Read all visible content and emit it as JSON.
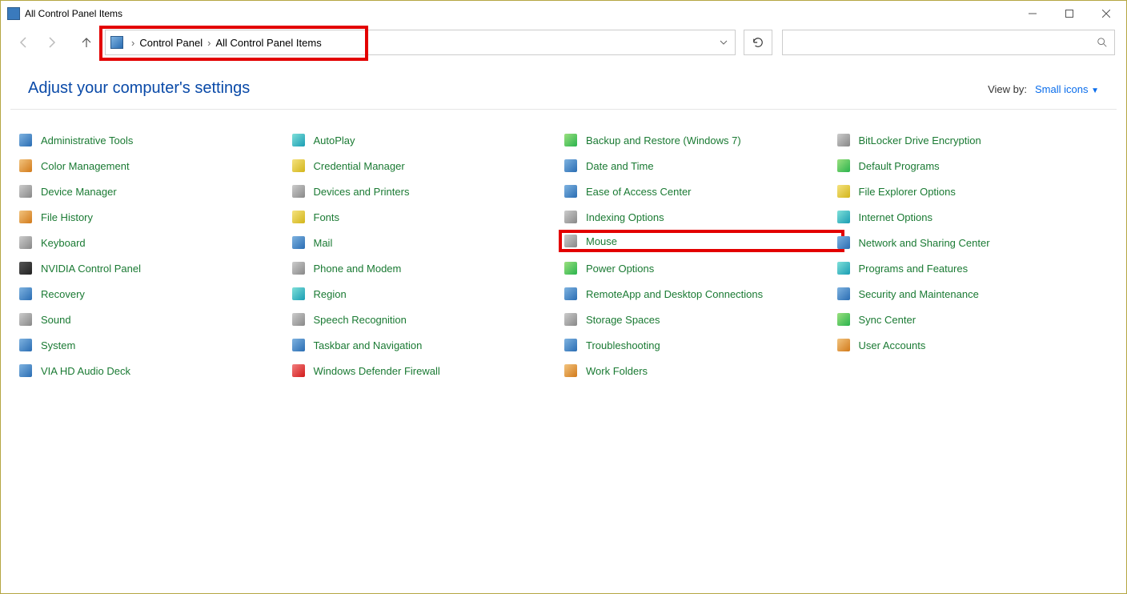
{
  "window_title": "All Control Panel Items",
  "breadcrumb": {
    "seg1": "Control Panel",
    "seg2": "All Control Panel Items"
  },
  "page_title": "Adjust your computer's settings",
  "viewby_label": "View by:",
  "viewby_value": "Small icons",
  "items": [
    {
      "label": "Administrative Tools",
      "icon": "c-blue"
    },
    {
      "label": "AutoPlay",
      "icon": "c-teal"
    },
    {
      "label": "Backup and Restore (Windows 7)",
      "icon": "c-green"
    },
    {
      "label": "BitLocker Drive Encryption",
      "icon": "c-grey"
    },
    {
      "label": "Color Management",
      "icon": "c-orange"
    },
    {
      "label": "Credential Manager",
      "icon": "c-yellow"
    },
    {
      "label": "Date and Time",
      "icon": "c-blue"
    },
    {
      "label": "Default Programs",
      "icon": "c-green"
    },
    {
      "label": "Device Manager",
      "icon": "c-grey"
    },
    {
      "label": "Devices and Printers",
      "icon": "c-grey"
    },
    {
      "label": "Ease of Access Center",
      "icon": "c-blue"
    },
    {
      "label": "File Explorer Options",
      "icon": "c-yellow"
    },
    {
      "label": "File History",
      "icon": "c-orange"
    },
    {
      "label": "Fonts",
      "icon": "c-yellow"
    },
    {
      "label": "Indexing Options",
      "icon": "c-grey"
    },
    {
      "label": "Internet Options",
      "icon": "c-teal"
    },
    {
      "label": "Keyboard",
      "icon": "c-grey"
    },
    {
      "label": "Mail",
      "icon": "c-blue"
    },
    {
      "label": "Mouse",
      "icon": "c-grey",
      "highlight": true
    },
    {
      "label": "Network and Sharing Center",
      "icon": "c-blue"
    },
    {
      "label": "NVIDIA Control Panel",
      "icon": "c-dark"
    },
    {
      "label": "Phone and Modem",
      "icon": "c-grey"
    },
    {
      "label": "Power Options",
      "icon": "c-green"
    },
    {
      "label": "Programs and Features",
      "icon": "c-teal"
    },
    {
      "label": "Recovery",
      "icon": "c-blue"
    },
    {
      "label": "Region",
      "icon": "c-teal"
    },
    {
      "label": "RemoteApp and Desktop Connections",
      "icon": "c-blue"
    },
    {
      "label": "Security and Maintenance",
      "icon": "c-blue"
    },
    {
      "label": "Sound",
      "icon": "c-grey"
    },
    {
      "label": "Speech Recognition",
      "icon": "c-grey"
    },
    {
      "label": "Storage Spaces",
      "icon": "c-grey"
    },
    {
      "label": "Sync Center",
      "icon": "c-green"
    },
    {
      "label": "System",
      "icon": "c-blue"
    },
    {
      "label": "Taskbar and Navigation",
      "icon": "c-blue"
    },
    {
      "label": "Troubleshooting",
      "icon": "c-blue"
    },
    {
      "label": "User Accounts",
      "icon": "c-orange"
    },
    {
      "label": "VIA HD Audio Deck",
      "icon": "c-blue"
    },
    {
      "label": "Windows Defender Firewall",
      "icon": "c-red"
    },
    {
      "label": "Work Folders",
      "icon": "c-orange"
    }
  ]
}
